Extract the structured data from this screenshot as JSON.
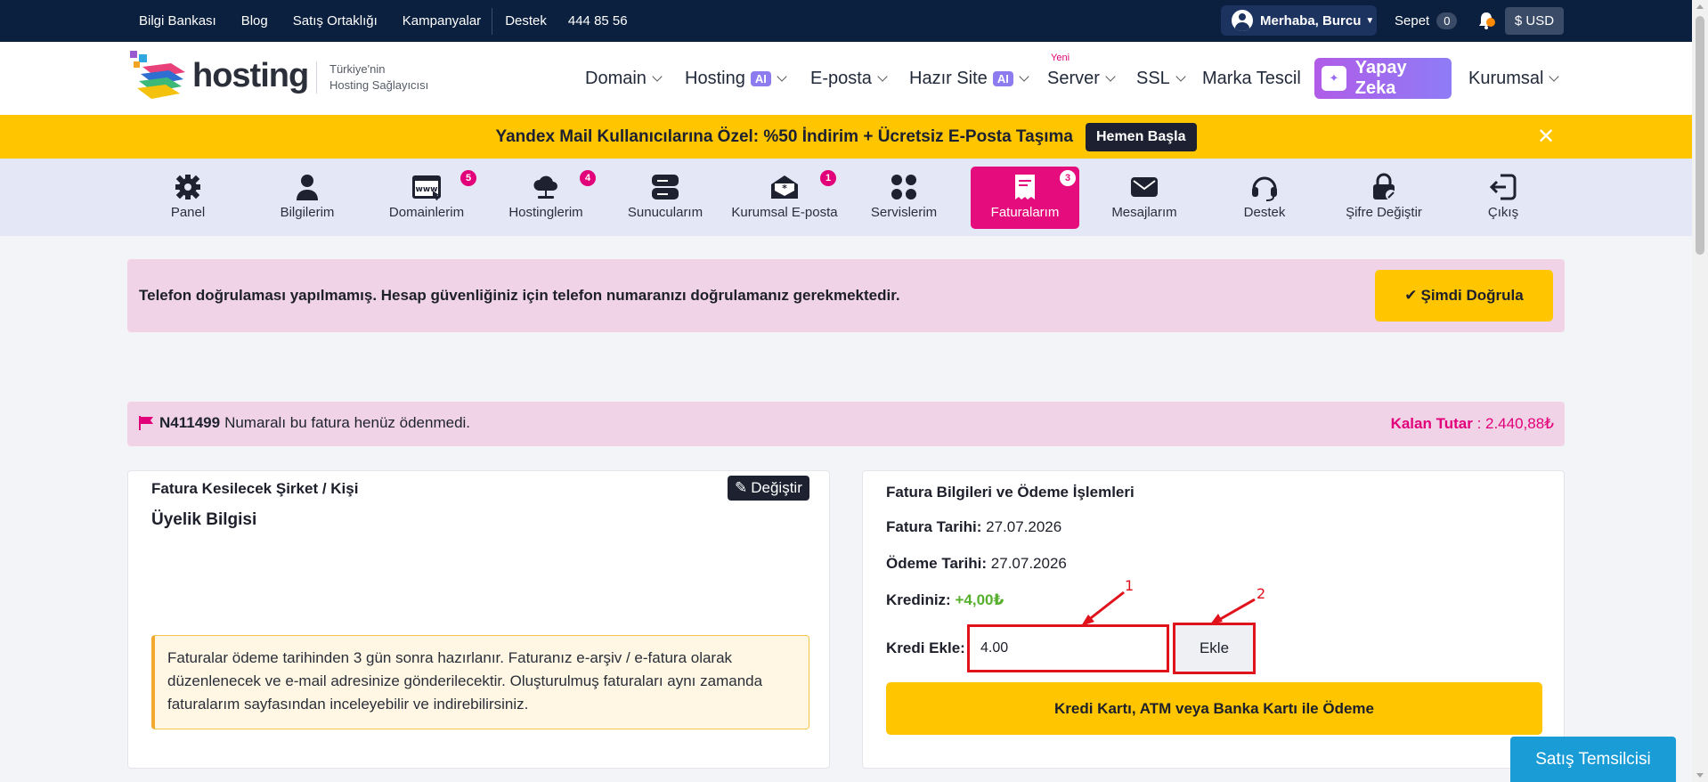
{
  "topbar": {
    "links": [
      "Bilgi Bankası",
      "Blog",
      "Satış Ortaklığı",
      "Kampanyalar"
    ],
    "support_label": "Destek",
    "phone": "444 85 56",
    "user_greeting": "Merhaba, Burcu",
    "cart_label": "Sepet",
    "cart_count": "0",
    "currency": "$ USD"
  },
  "header": {
    "logo_text": "hosting",
    "tagline_line1": "Türkiye'nin",
    "tagline_line2": "Hosting Sağlayıcısı",
    "nav": {
      "domain": "Domain",
      "hosting": "Hosting",
      "eposta": "E-posta",
      "hazir_site": "Hazır Site",
      "server": "Server",
      "ssl": "SSL",
      "marka": "Marka Tescil",
      "yapay_zeka": "Yapay Zeka",
      "kurumsal": "Kurumsal",
      "ai_badge": "AI",
      "yeni_badge": "Yeni"
    }
  },
  "promo": {
    "text": "Yandex Mail Kullanıcılarına Özel: %50 İndirim + Ücretsiz E-Posta Taşıma",
    "button": "Hemen Başla",
    "close": "✕"
  },
  "account_nav": [
    {
      "label": "Panel",
      "icon": "gear-icon",
      "count": ""
    },
    {
      "label": "Bilgilerim",
      "icon": "user-icon",
      "count": ""
    },
    {
      "label": "Domainlerim",
      "icon": "www-icon",
      "count": "5"
    },
    {
      "label": "Hostinglerim",
      "icon": "cloud-icon",
      "count": "4"
    },
    {
      "label": "Sunucularım",
      "icon": "server-icon",
      "count": ""
    },
    {
      "label": "Kurumsal E-posta",
      "icon": "mail-open-icon",
      "count": "1"
    },
    {
      "label": "Servislerim",
      "icon": "grid-icon",
      "count": ""
    },
    {
      "label": "Faturalarım",
      "icon": "invoice-icon",
      "count": "3"
    },
    {
      "label": "Mesajlarım",
      "icon": "envelope-icon",
      "count": ""
    },
    {
      "label": "Destek",
      "icon": "headset-icon",
      "count": ""
    },
    {
      "label": "Şifre Değiştir",
      "icon": "lock-icon",
      "count": ""
    },
    {
      "label": "Çıkış",
      "icon": "logout-icon",
      "count": ""
    }
  ],
  "phone_alert": {
    "message": "Telefon doğrulaması yapılmamış. Hesap güvenliğiniz için telefon numaranızı doğrulamanız gerekmektedir.",
    "button": "Şimdi Doğrula"
  },
  "invoice_status": {
    "number": "N411499",
    "text": "Numaralı bu fatura henüz ödenmedi.",
    "remaining_label": "Kalan Tutar",
    "remaining_value": ": 2.440,88₺"
  },
  "left_card": {
    "title": "Fatura Kesilecek Şirket / Kişi",
    "edit_button": "Değiştir",
    "subtitle": "Üyelik Bilgisi",
    "info": "Faturalar ödeme tarihinden 3 gün sonra hazırlanır. Faturanız e-arşiv / e-fatura olarak düzenlenecek ve e-mail adresinize gönderilecektir. Oluşturulmuş faturaları aynı zamanda faturalarım sayfasından inceleyebilir ve indirebilirsiniz."
  },
  "right_card": {
    "title": "Fatura Bilgileri ve Ödeme İşlemleri",
    "invoice_date_label": "Fatura Tarihi:",
    "invoice_date": "27.07.2026",
    "payment_date_label": "Ödeme Tarihi:",
    "payment_date": "27.07.2026",
    "credit_label": "Krediniz:",
    "credit_value": "+4,00₺",
    "add_credit_label": "Kredi Ekle:",
    "add_credit_value": "4.00",
    "add_button": "Ekle",
    "pay_button": "Kredi Kartı, ATM veya Banka Kartı ile Ödeme"
  },
  "annotations": {
    "one": "1",
    "two": "2",
    "color": "#e0121c"
  },
  "sales_button": "Satış Temsilcisi",
  "colors": {
    "navy": "#0b1f3f",
    "yellow": "#ffc600",
    "pink": "#e50d7d",
    "light_pink": "#f0d3e6"
  }
}
